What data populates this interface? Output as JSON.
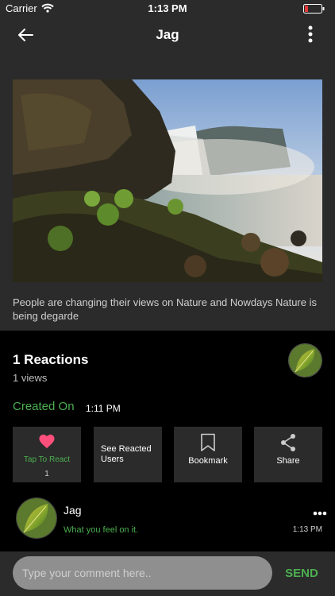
{
  "status": {
    "carrier": "Carrier",
    "time": "1:13 PM"
  },
  "nav": {
    "title": "Jag"
  },
  "post": {
    "caption": "People are changing their views on Nature and Nowdays Nature is being degarde"
  },
  "info": {
    "reactions": "1 Reactions",
    "views": "1 views",
    "created_label": "Created On",
    "created_time": "1:11 PM"
  },
  "actions": [
    {
      "label": "Tap To React",
      "count": "1",
      "icon": "heart-icon"
    },
    {
      "label": "See Reacted Users",
      "icon": "none"
    },
    {
      "label": "Bookmark",
      "icon": "bookmark-icon"
    },
    {
      "label": "Share",
      "icon": "share-icon"
    }
  ],
  "comment": {
    "author": "Jag",
    "text": "What you feel on it.",
    "time": "1:13 PM"
  },
  "composer": {
    "placeholder": "Type your comment here..",
    "send": "SEND"
  },
  "colors": {
    "accent": "#4caf50",
    "heart": "#ff4f7b",
    "panel": "#2b2b2b",
    "background": "#000000"
  }
}
